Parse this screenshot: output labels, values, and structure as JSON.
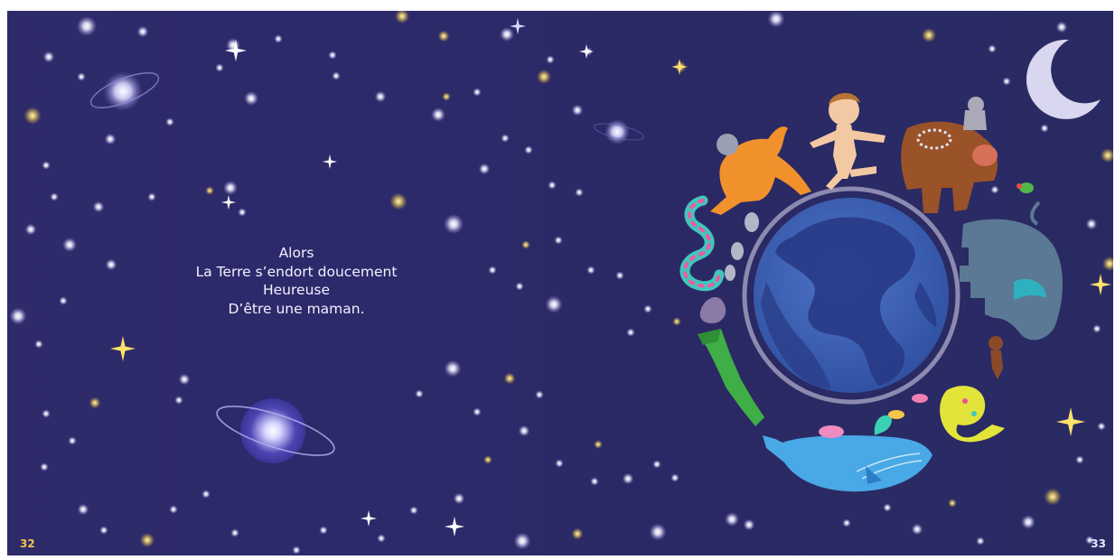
{
  "text": {
    "lines": [
      "Alors",
      "La Terre s’endort doucement",
      "Heureuse",
      "D’être une maman."
    ]
  },
  "page_numbers": {
    "left": "32",
    "right": "33"
  },
  "colors": {
    "sky": "#2c2a6b",
    "text": "#f4f1ff",
    "page_number_left": "#f1c44a",
    "page_number_right": "#e8e6ff",
    "star_yellow": "#ffe58a",
    "star_white": "#ffffff",
    "earth_ocean": "#3d5fb2",
    "earth_land": "#283a86",
    "earth_ring": "#8d8ab0"
  },
  "illustrations": [
    "crescent-moon",
    "ringed-planet",
    "earth-globe",
    "child",
    "kangaroo",
    "koala",
    "snake",
    "mouse",
    "squirrel",
    "crocodile",
    "whale",
    "lizard",
    "elephant",
    "monkey",
    "orangutan",
    "lemur",
    "bird",
    "fish"
  ]
}
